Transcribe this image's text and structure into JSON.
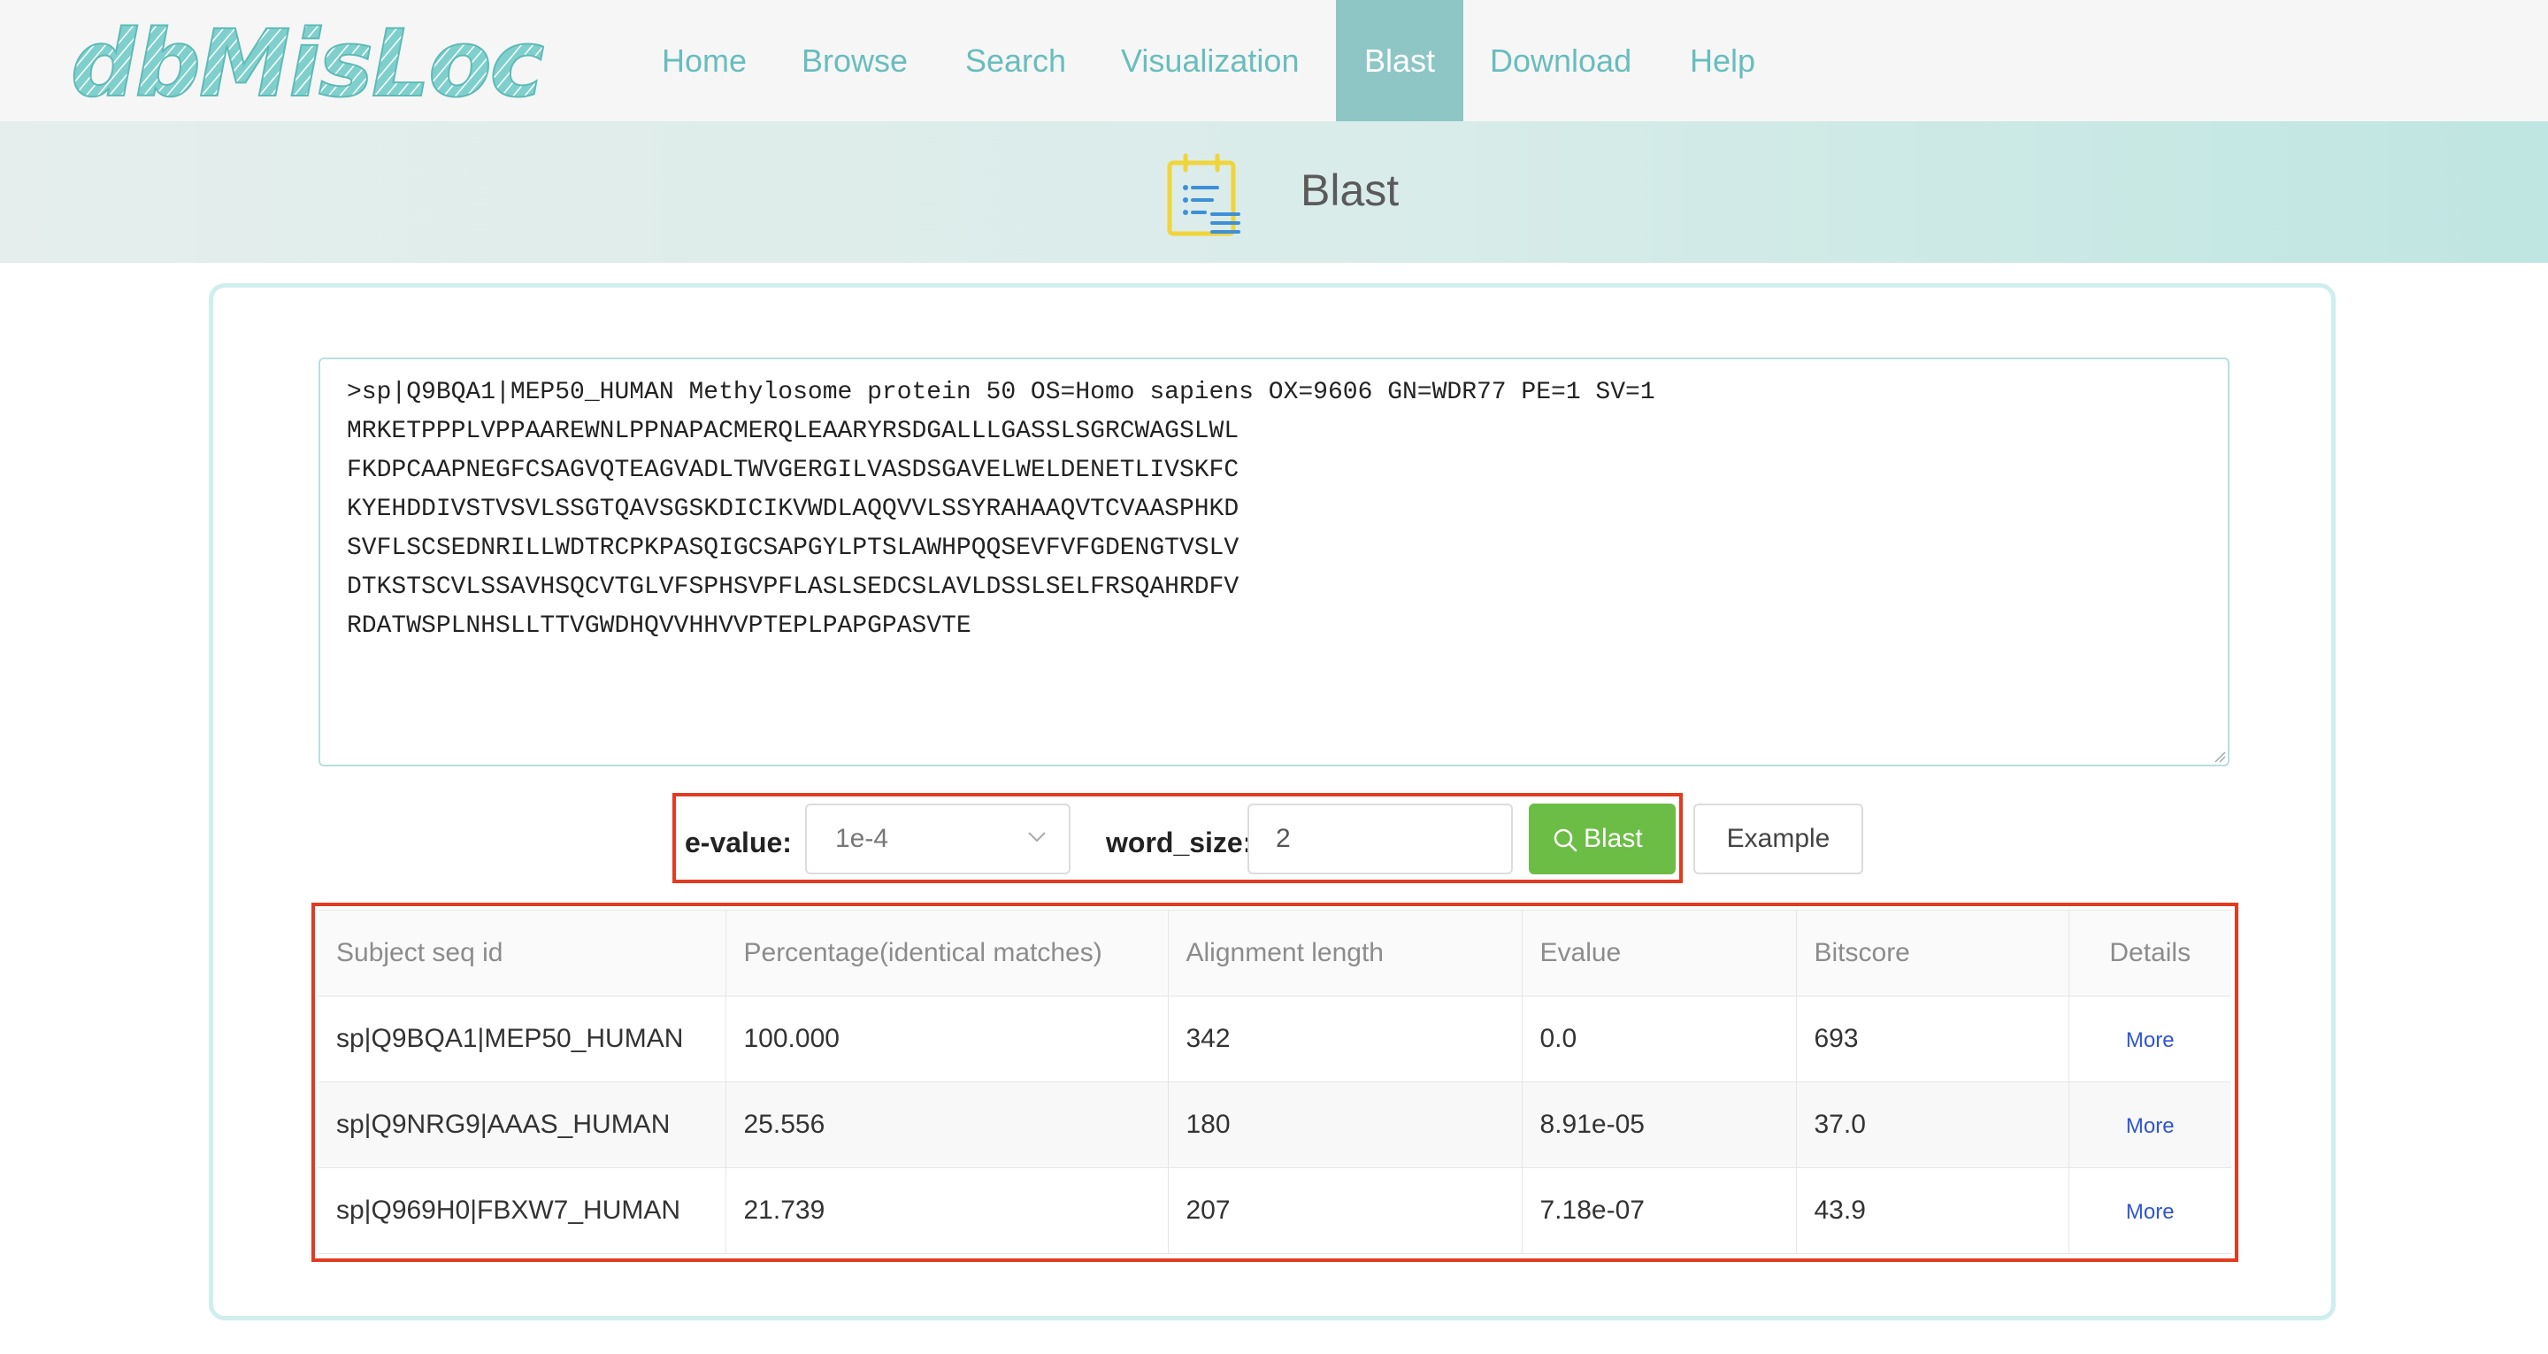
{
  "brand": {
    "logo_text": "dbMisLoc"
  },
  "nav": {
    "items": [
      {
        "label": "Home",
        "active": false
      },
      {
        "label": "Browse",
        "active": false
      },
      {
        "label": "Search",
        "active": false
      },
      {
        "label": "Visualization",
        "active": false
      },
      {
        "label": "Blast",
        "active": true
      },
      {
        "label": "Download",
        "active": false
      },
      {
        "label": "Help",
        "active": false
      }
    ]
  },
  "header": {
    "title": "Blast",
    "icon": "document-list-icon"
  },
  "query": {
    "sequence": ">sp|Q9BQA1|MEP50_HUMAN Methylosome protein 50 OS=Homo sapiens OX=9606 GN=WDR77 PE=1 SV=1\nMRKETPPPLVPPAAREWNLPPNAPACMERQLEAARYRSDGALLLGASSLSGRCWAGSLWL\nFKDPCAAPNEGFCSAGVQTEAGVADLTWVGERGILVASDSGAVELWELDENETLIVSKFC\nKYEHDDIVSTVSVLSSGTQAVSGSKDICIKVWDLAQQVVLSSYRAHAAQVTCVAASPHKD\nSVFLSCSEDNRILLWDTRCPKPASQIGCSAPGYLPTSLAWHPQQSEVFVFGDENGTVSLV\nDTKSTSCVLSSAVHSQCVTGLVFSPHSVPFLASLSEDCSLAVLDSSLSELFRSQAHRDFV\nRDATWSPLNHSLLTTVGWDHQVVHHVVPTEPLPAPGPASVTE"
  },
  "params": {
    "evalue_label": "e-value:",
    "evalue_value": "1e-4",
    "word_size_label": "word_size:",
    "word_size_value": "2",
    "blast_button": "Blast",
    "example_button": "Example"
  },
  "results": {
    "columns": [
      "Subject seq id",
      "Percentage(identical matches)",
      "Alignment length",
      "Evalue",
      "Bitscore",
      "Details"
    ],
    "rows": [
      {
        "subject": "sp|Q9BQA1|MEP50_HUMAN",
        "percentage": "100.000",
        "length": "342",
        "evalue": "0.0",
        "bitscore": "693",
        "details": "More"
      },
      {
        "subject": "sp|Q9NRG9|AAAS_HUMAN",
        "percentage": "25.556",
        "length": "180",
        "evalue": "8.91e-05",
        "bitscore": "37.0",
        "details": "More"
      },
      {
        "subject": "sp|Q969H0|FBXW7_HUMAN",
        "percentage": "21.739",
        "length": "207",
        "evalue": "7.18e-07",
        "bitscore": "43.9",
        "details": "More"
      }
    ]
  },
  "colors": {
    "brand_teal": "#69bdbd",
    "nav_active": "#8ec6c6",
    "blast_green": "#6cbd45",
    "highlight_red": "#e23b22",
    "link_blue": "#2f55d4"
  }
}
